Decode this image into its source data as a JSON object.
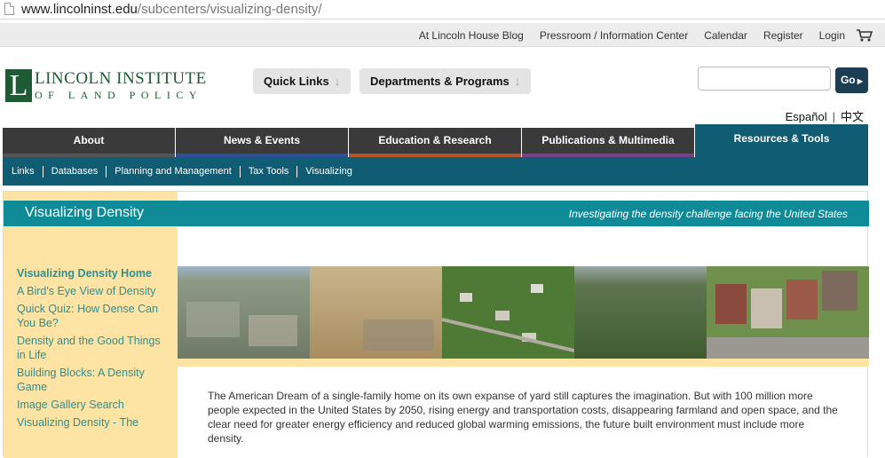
{
  "browser": {
    "url_host": "www.lincolninst.edu",
    "url_path": "/subcenters/visualizing-density/"
  },
  "utility_nav": [
    "At Lincoln House Blog",
    "Pressroom / Information Center",
    "Calendar",
    "Register",
    "Login"
  ],
  "logo": {
    "letter": "L",
    "line1": "LINCOLN INSTITUTE",
    "line2": "OF LAND POLICY"
  },
  "quick_links": {
    "label": "Quick Links",
    "arrow": "↓"
  },
  "departments": {
    "label": "Departments & Programs",
    "arrow": "↓"
  },
  "search": {
    "placeholder": "",
    "go_label": "Go"
  },
  "languages": [
    "Español",
    "中文"
  ],
  "main_nav": [
    {
      "label": "About",
      "accent": "#555555"
    },
    {
      "label": "News & Events",
      "accent": "#2b4f9e"
    },
    {
      "label": "Education & Research",
      "accent": "#b5562a"
    },
    {
      "label": "Publications & Multimedia",
      "accent": "#7a3f8f"
    },
    {
      "label": "Resources & Tools",
      "accent": "#0f5c73"
    }
  ],
  "sub_nav": [
    "Links",
    "Databases",
    "Planning and Management",
    "Tax Tools",
    "Visualizing"
  ],
  "banner": {
    "title": "Visualizing Density",
    "subtitle": "Investigating the density challenge facing the United States"
  },
  "sidebar_links": [
    "Visualizing Density Home",
    "A Bird's Eye View of Density",
    "Quick Quiz: How Dense Can You Be?",
    "Density and the Good Things in Life",
    "Building Blocks: A Density Game",
    "Image Gallery Search",
    "Visualizing Density - The"
  ],
  "intro_text": "The American Dream of a single-family home on its own expanse of yard still captures the imagination. But with 100 million more people expected in the United States by 2050, rising energy and transportation costs, disappearing farmland and open space, and the clear need for greater energy efficiency and reduced global warming emissions, the future built environment must include more density.",
  "colors": {
    "brand_green": "#1e5a34",
    "teal_nav": "#0f5c73",
    "banner_teal": "#0e8b96",
    "sidebar_yellow": "#fde3a4",
    "link_teal": "#2f8f93"
  }
}
